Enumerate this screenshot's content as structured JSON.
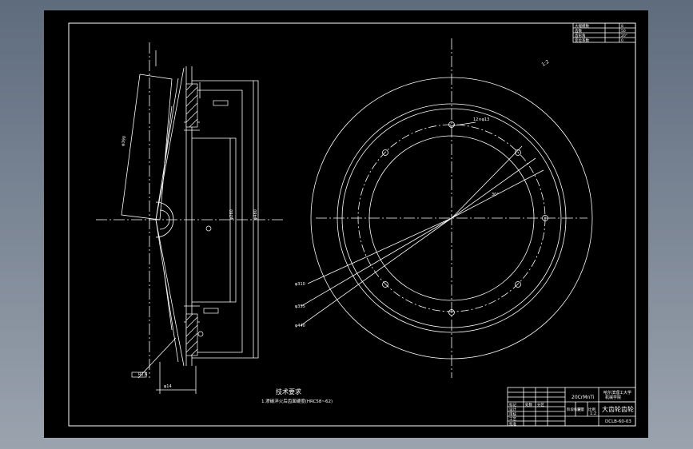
{
  "drawing": {
    "tech_req_title": "技术要求",
    "tech_req_note": "1.渗碳淬火后齿面硬度(HRC58~62)",
    "part_name": "大齿轮齿轮",
    "drawing_no": "DCLB-60-03",
    "material": "20CrMnTi",
    "scale": "1:2",
    "org_line1": "哈尔滨理工大学",
    "org_line2": "机械学院",
    "params": [
      {
        "k": "大端模数",
        "v": "8"
      },
      {
        "k": "齿数",
        "v": "50"
      },
      {
        "k": "齿形角",
        "v": "20°"
      },
      {
        "k": "变位系数",
        "v": "0"
      }
    ],
    "title_cells": [
      "标记",
      "处数",
      "分区",
      "更改文件号",
      "签名",
      "年月日",
      "设计",
      "审核",
      "工艺",
      "批准",
      "阶段标记",
      "重量",
      "比例"
    ],
    "dims": [
      "φ260",
      "φ310",
      "φ355",
      "φ390",
      "φ440",
      "φ480",
      "12×φ13",
      "R1.6",
      "30°",
      "1:2",
      "φ14"
    ]
  }
}
